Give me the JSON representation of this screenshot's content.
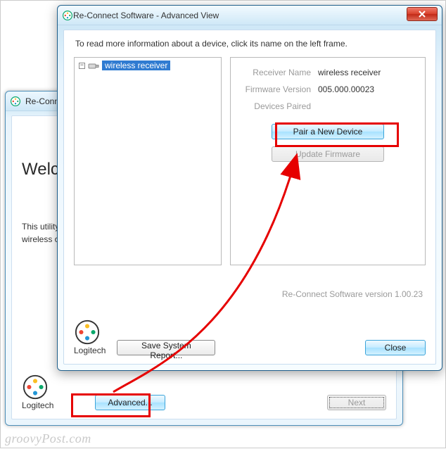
{
  "watermark": "groovyPost.com",
  "back_window": {
    "title": "Re-Conn",
    "welcome": "Welco",
    "desc_line1": "This utility",
    "desc_line2": "wireless c",
    "logo_label": "Logitech",
    "advanced_label": "Advanced...",
    "next_label": "Next"
  },
  "front_window": {
    "title": "Re-Connect Software - Advanced View",
    "instruction": "To read more information about a device, click its name on the left frame.",
    "tree": {
      "collapse_glyph": "−",
      "item_label": "wireless receiver"
    },
    "info": {
      "receiver_name_label": "Receiver Name",
      "receiver_name_value": "wireless receiver",
      "firmware_label": "Firmware Version",
      "firmware_value": "005.000.00023",
      "devices_paired_label": "Devices Paired"
    },
    "buttons": {
      "pair_label": "Pair a New Device",
      "update_fw_label": "Update Firmware",
      "save_report_label": "Save System Report...",
      "close_label": "Close"
    },
    "sw_version": "Re-Connect Software version 1.00.23",
    "logo_label": "Logitech"
  }
}
